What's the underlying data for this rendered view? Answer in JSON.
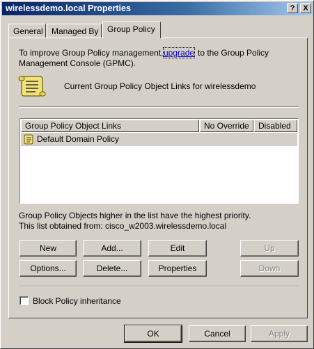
{
  "window": {
    "title": "wirelessdemo.local Properties",
    "help_button": "?",
    "close_button": "X"
  },
  "tabs": [
    {
      "label": "General",
      "active": false
    },
    {
      "label": "Managed By",
      "active": false
    },
    {
      "label": "Group Policy",
      "active": true
    }
  ],
  "info": {
    "line1_prefix": "To improve Group Policy management,",
    "link": "upgrade",
    "line1_suffix": "to the Group Policy",
    "line2": "Management Console (GPMC).",
    "current_links": "Current Group Policy Object Links for wirelessdemo"
  },
  "list": {
    "columns": [
      "Group Policy Object Links",
      "No Override",
      "Disabled"
    ],
    "rows": [
      {
        "name": "Default Domain Policy",
        "no_override": "",
        "disabled": ""
      }
    ]
  },
  "notes": {
    "priority": "Group Policy Objects higher in the list have the highest priority.",
    "obtained": "This list obtained from: cisco_w2003.wirelessdemo.local"
  },
  "buttons": {
    "new": "New",
    "add": "Add...",
    "edit": "Edit",
    "up": "Up",
    "options": "Options...",
    "delete": "Delete...",
    "properties": "Properties",
    "down": "Down"
  },
  "block_inheritance": {
    "label": "Block Policy inheritance",
    "checked": false
  },
  "footer": {
    "ok": "OK",
    "cancel": "Cancel",
    "apply": "Apply"
  }
}
